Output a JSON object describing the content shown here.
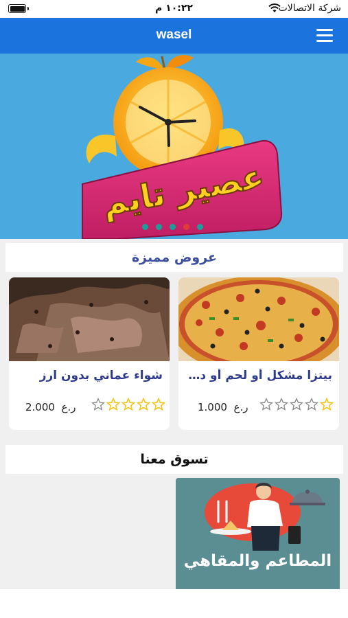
{
  "status_bar": {
    "carrier": "شركة الاتصالات",
    "time": "١٠:٢٢ م"
  },
  "header": {
    "title": "wasel"
  },
  "banner": {
    "logo_text": "عصير تايم",
    "slides": 5,
    "active_slide": 4
  },
  "featured": {
    "title": "عروض مميزة",
    "products": [
      {
        "name": "بيتزا مشكل أو لحم أو دجاج",
        "price": "1.000",
        "currency": "ر.ع",
        "rating": 1
      },
      {
        "name": "شواء عماني بدون ارز",
        "price": "2.000",
        "currency": "ر.ع",
        "rating": 4
      }
    ]
  },
  "shop_with_us": {
    "title": "تسوق معنا",
    "tiles": [
      {
        "label": "المطاعم والمقاهي"
      }
    ]
  },
  "colors": {
    "header_blue": "#1b73de",
    "banner_blue": "#4aa9de",
    "star_yellow": "#f5c518",
    "title_navy": "#3a4f9e",
    "tile_teal": "#5a8e92"
  }
}
